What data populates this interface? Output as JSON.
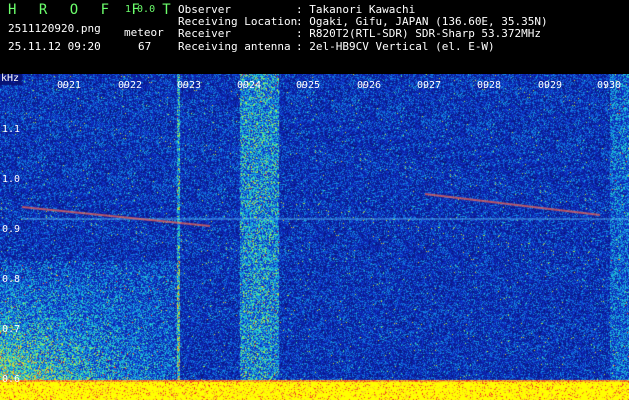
{
  "app": {
    "name": "H R O F F T",
    "version": "1.0.0"
  },
  "file": {
    "name": "2511120920.png",
    "datetime": "25.11.12 09:20"
  },
  "mode": {
    "label": "meteor",
    "count": "67"
  },
  "station": {
    "observer_label": "Observer",
    "observer": "Takanori Kawachi",
    "location_label": "Receiving Location",
    "location": "Ogaki, Gifu, JAPAN (136.60E, 35.35N)",
    "receiver_label": "Receiver",
    "receiver": "R820T2(RTL-SDR) SDR-Sharp 53.372MHz",
    "antenna_label": "Receiving antenna",
    "antenna": "2el-HB9CV Vertical (el. E-W)"
  },
  "axis": {
    "unit": "kHz",
    "freq_ticks": [
      "1.1",
      "1.0",
      "0.9",
      "0.8",
      "0.7",
      "0.6"
    ],
    "time_ticks": [
      "0921",
      "0922",
      "0923",
      "0924",
      "0925",
      "0926",
      "0927",
      "0928",
      "0929",
      "0930"
    ]
  },
  "colors": {
    "logo": "#6cff6c",
    "background": "#000000",
    "waterfall_base": "#0a23a6",
    "carrier_line": "#5fc8ff"
  }
}
